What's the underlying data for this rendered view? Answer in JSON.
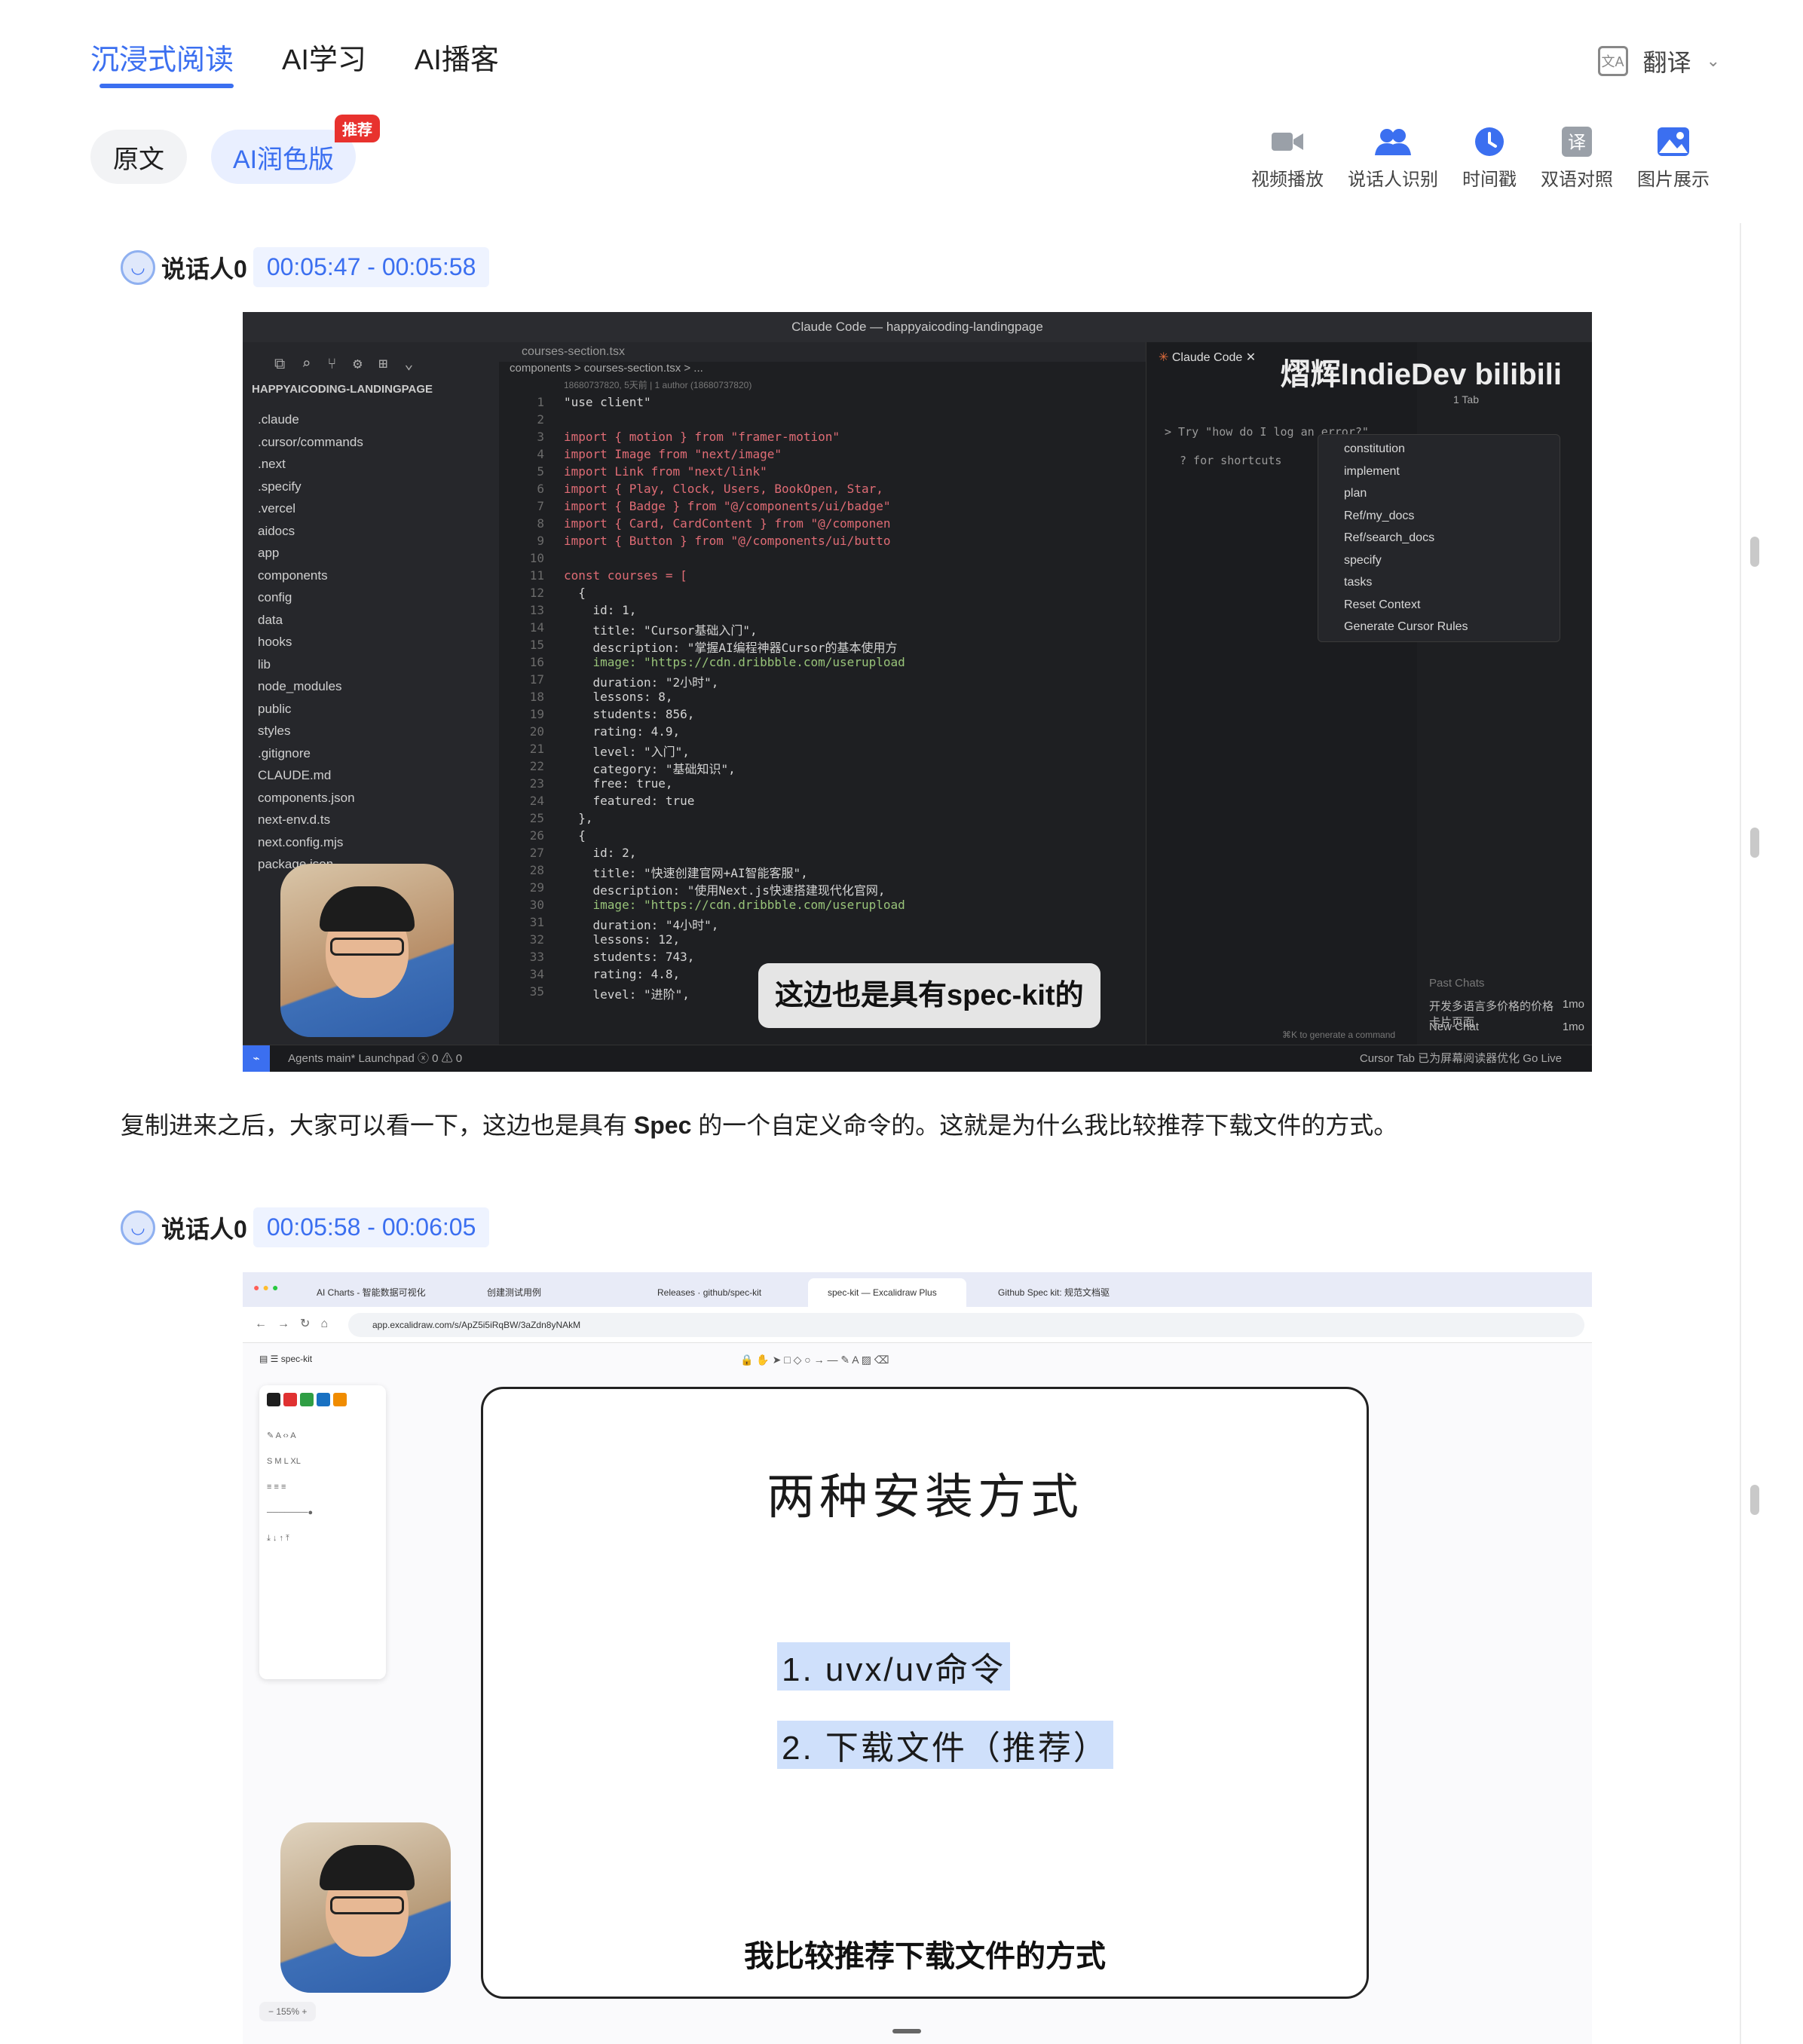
{
  "nav": {
    "tabs": [
      {
        "label": "沉浸式阅读",
        "active": true
      },
      {
        "label": "AI学习",
        "active": false
      },
      {
        "label": "AI播客",
        "active": false
      }
    ],
    "translate_label": "翻译"
  },
  "version": {
    "original_label": "原文",
    "ai_label": "AI润色版",
    "ai_badge": "推荐"
  },
  "tools": [
    {
      "label": "视频播放",
      "icon": "video-camera-icon"
    },
    {
      "label": "说话人识别",
      "icon": "speakers-icon"
    },
    {
      "label": "时间戳",
      "icon": "clock-icon"
    },
    {
      "label": "双语对照",
      "icon": "translate-icon"
    },
    {
      "label": "图片展示",
      "icon": "image-icon"
    }
  ],
  "segments": [
    {
      "speaker": "说话人0",
      "time_range": "00:05:47 - 00:05:58",
      "frame": {
        "window_title": "Claude Code — happyaicoding-landingpage",
        "editor_tab": "courses-section.tsx",
        "chat_tab": "Claude Code",
        "explorer_title": "HAPPYAICODING-LANDINGPAGE",
        "files": [
          ".claude",
          ".cursor/commands",
          ".next",
          ".specify",
          ".vercel",
          "aidocs",
          "app",
          "components",
          "config",
          "data",
          "hooks",
          "lib",
          "node_modules",
          "public",
          "styles",
          ".gitignore",
          "CLAUDE.md",
          "components.json",
          "next-env.d.ts",
          "next.config.mjs",
          "package.json"
        ],
        "breadcrumb": "components > courses-section.tsx > ...",
        "blame": "18680737820, 5天前 | 1 author (18680737820)",
        "code_lines": [
          "\"use client\"",
          "",
          "import { motion } from \"framer-motion\"",
          "import Image from \"next/image\"",
          "import Link from \"next/link\"",
          "import { Play, Clock, Users, BookOpen, Star,",
          "import { Badge } from \"@/components/ui/badge\"",
          "import { Card, CardContent } from \"@/componen",
          "import { Button } from \"@/components/ui/butto",
          "",
          "const courses = [",
          "  {",
          "    id: 1,",
          "    title: \"Cursor基础入门\",",
          "    description: \"掌握AI编程神器Cursor的基本使用方",
          "    image: \"https://cdn.dribbble.com/userupload",
          "    duration: \"2小时\",",
          "    lessons: 8,",
          "    students: 856,",
          "    rating: 4.9,",
          "    level: \"入门\",",
          "    category: \"基础知识\",",
          "    free: true,",
          "    featured: true",
          "  },",
          "  {",
          "    id: 2,",
          "    title: \"快速创建官网+AI智能客服\",",
          "    description: \"使用Next.js快速搭建现代化官网,",
          "    image: \"https://cdn.dribbble.com/userupload",
          "    duration: \"4小时\",",
          "    lessons: 12,",
          "    students: 743,",
          "    rating: 4.8,",
          "    level: \"进阶\","
        ],
        "chat_hint": "> Try \"how do I log an error?\"",
        "chat_shortcuts": "? for shortcuts",
        "chat_bottom": "⌘K to generate a command",
        "menu_tab": "1 Tab",
        "menu_items": [
          "constitution",
          "implement",
          "plan",
          "Ref/my_docs",
          "Ref/search_docs",
          "specify",
          "tasks",
          "Reset Context",
          "Generate Cursor Rules"
        ],
        "past_chats_label": "Past Chats",
        "past_chats": [
          {
            "title": "开发多语言多价格的价格卡片页面",
            "age": "1mo"
          },
          {
            "title": "New Chat",
            "age": "1mo"
          }
        ],
        "status_left": "Agents   main*   Launchpad   ⓧ 0 ⚠ 0",
        "status_right": "Cursor Tab     已为屏幕阅读器优化     Go Live",
        "watermark": "熠辉IndieDev",
        "brand": "bilibili",
        "subtitle": "这边也是具有spec-kit的"
      }
    },
    {
      "speaker": "说话人0",
      "time_range": "00:05:58 - 00:06:05",
      "frame": {
        "browser_tabs": [
          "AI Charts - 智能数据可视化",
          "创建测试用例",
          "Releases · github/spec-kit",
          "spec-kit — Excalidraw Plus",
          "Github Spec kit: 规范文档驱"
        ],
        "url": "app.excalidraw.com/s/ApZ5i5iRqBW/3aZdn8yNAkM",
        "file_name": "spec-kit",
        "slide_title": "两种安装方式",
        "items": [
          "1. uvx/uv命令",
          "2. 下载文件（推荐）"
        ],
        "subtitle": "我比较推荐下载文件的方式",
        "zoom": "155%"
      }
    }
  ],
  "paragraph": {
    "before": "复制进来之后，大家可以看一下，这边也是具有 ",
    "bold": "Spec",
    "after": " 的一个自定义命令的。这就是为什么我比较推荐下载文件的方式。"
  },
  "colors": {
    "accent": "#3b6ff0",
    "badge": "#e8322e",
    "ai_pill_bg": "#e9efff"
  }
}
